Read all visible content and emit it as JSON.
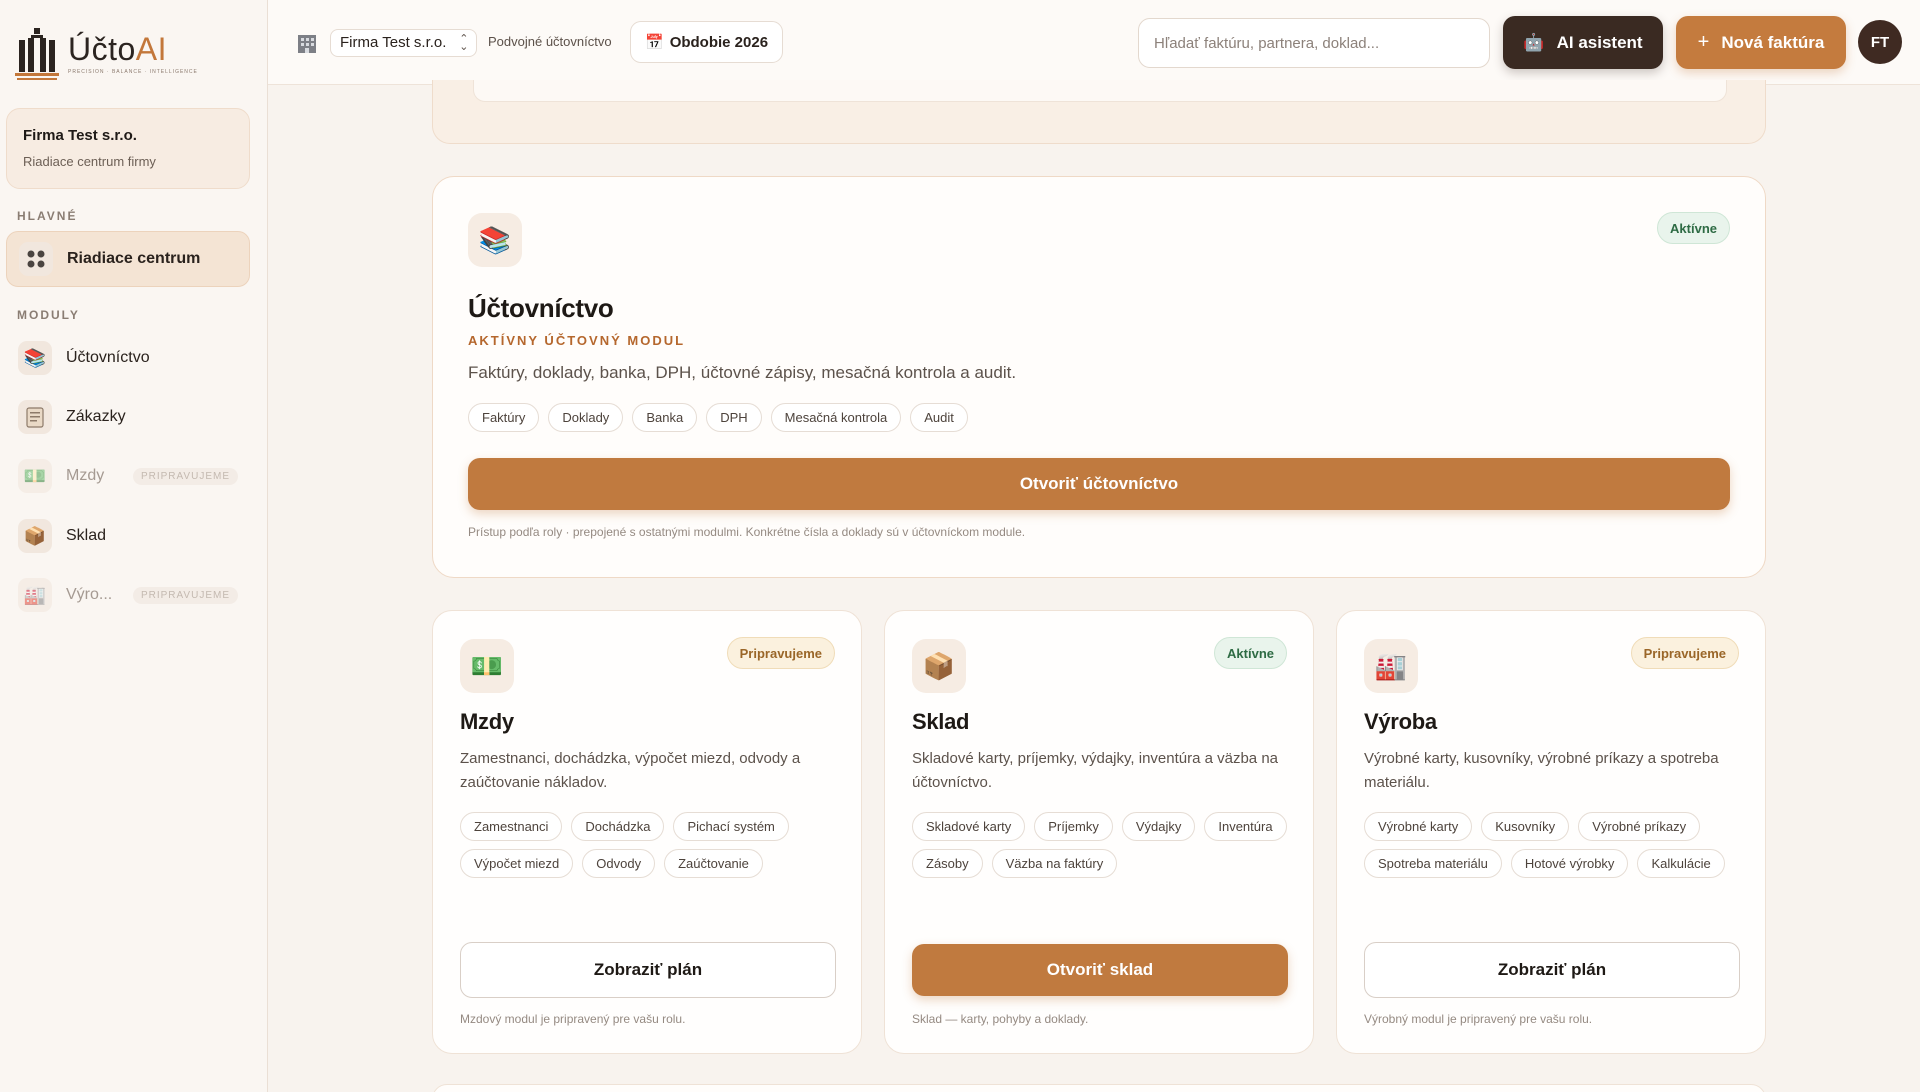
{
  "app": {
    "logo_word_main": "Účto",
    "logo_word_accent": "AI",
    "logo_tagline": "PRECISION · BALANCE · INTELLIGENCE"
  },
  "sidebar": {
    "company_name": "Firma Test s.r.o.",
    "company_subtitle": "Riadiace centrum firmy",
    "section_main": "HLAVNÉ",
    "section_modules": "MODULY",
    "main_items": [
      {
        "label": "Riadiace centrum",
        "icon": "dashboard-icon"
      }
    ],
    "module_items": [
      {
        "label": "Účtovníctvo",
        "icon": "books-icon",
        "badge": ""
      },
      {
        "label": "Zákazky",
        "icon": "clipboard-icon",
        "badge": ""
      },
      {
        "label": "Mzdy",
        "icon": "money-icon",
        "badge": "PRIPRAVUJEME"
      },
      {
        "label": "Sklad",
        "icon": "package-icon",
        "badge": ""
      },
      {
        "label": "Výro...",
        "icon": "factory-icon",
        "badge": "PRIPRAVUJEME"
      }
    ]
  },
  "topbar": {
    "company_select": "Firma Test s.r.o.",
    "accounting_type": "Podvojné účtovníctvo",
    "period": "Obdobie 2026",
    "search_placeholder": "Hľadať faktúru, partnera, doklad...",
    "ai_button": "AI asistent",
    "new_invoice_button": "Nová faktúra",
    "avatar_initials": "FT"
  },
  "hero": {
    "icon": "books-icon",
    "status": "Aktívne",
    "title": "Účtovníctvo",
    "subtitle": "AKTÍVNY ÚČTOVNÝ MODUL",
    "description": "Faktúry, doklady, banka, DPH, účtovné zápisy, mesačná kontrola a audit.",
    "tags": [
      "Faktúry",
      "Doklady",
      "Banka",
      "DPH",
      "Mesačná kontrola",
      "Audit"
    ],
    "button": "Otvoriť účtovníctvo",
    "note": "Prístup podľa roly · prepojené s ostatnými modulmi. Konkrétne čísla a doklady sú v účtovníckom module."
  },
  "cards": [
    {
      "icon": "money-icon",
      "status": "Pripravujeme",
      "title": "Mzdy",
      "description": "Zamestnanci, dochádzka, výpočet miezd, odvody a zaúčtovanie nákladov.",
      "tags": [
        "Zamestnanci",
        "Dochádzka",
        "Pichací systém",
        "Výpočet miezd",
        "Odvody",
        "Zaúčtovanie"
      ],
      "button": "Zobraziť plán",
      "note": "Mzdový modul je pripravený pre vašu rolu."
    },
    {
      "icon": "package-icon",
      "status": "Aktívne",
      "title": "Sklad",
      "description": "Skladové karty, príjemky, výdajky, inventúra a väzba na účtovníctvo.",
      "tags": [
        "Skladové karty",
        "Príjemky",
        "Výdajky",
        "Inventúra",
        "Zásoby",
        "Väzba na faktúry"
      ],
      "button": "Otvoriť sklad",
      "note": "Sklad — karty, pohyby a doklady."
    },
    {
      "icon": "factory-icon",
      "status": "Pripravujeme",
      "title": "Výroba",
      "description": "Výrobné karty, kusovníky, výrobné príkazy a spotreba materiálu.",
      "tags": [
        "Výrobné karty",
        "Kusovníky",
        "Výrobné príkazy",
        "Spotreba materiálu",
        "Hotové výrobky",
        "Kalkulácie"
      ],
      "button": "Zobraziť plán",
      "note": "Výrobný modul je pripravený pre vašu rolu."
    }
  ],
  "colors": {
    "accent": "#c07a3f",
    "dark_button": "#3a2a22",
    "active_badge": "#2e6b44",
    "soon_badge": "#9a6628"
  }
}
